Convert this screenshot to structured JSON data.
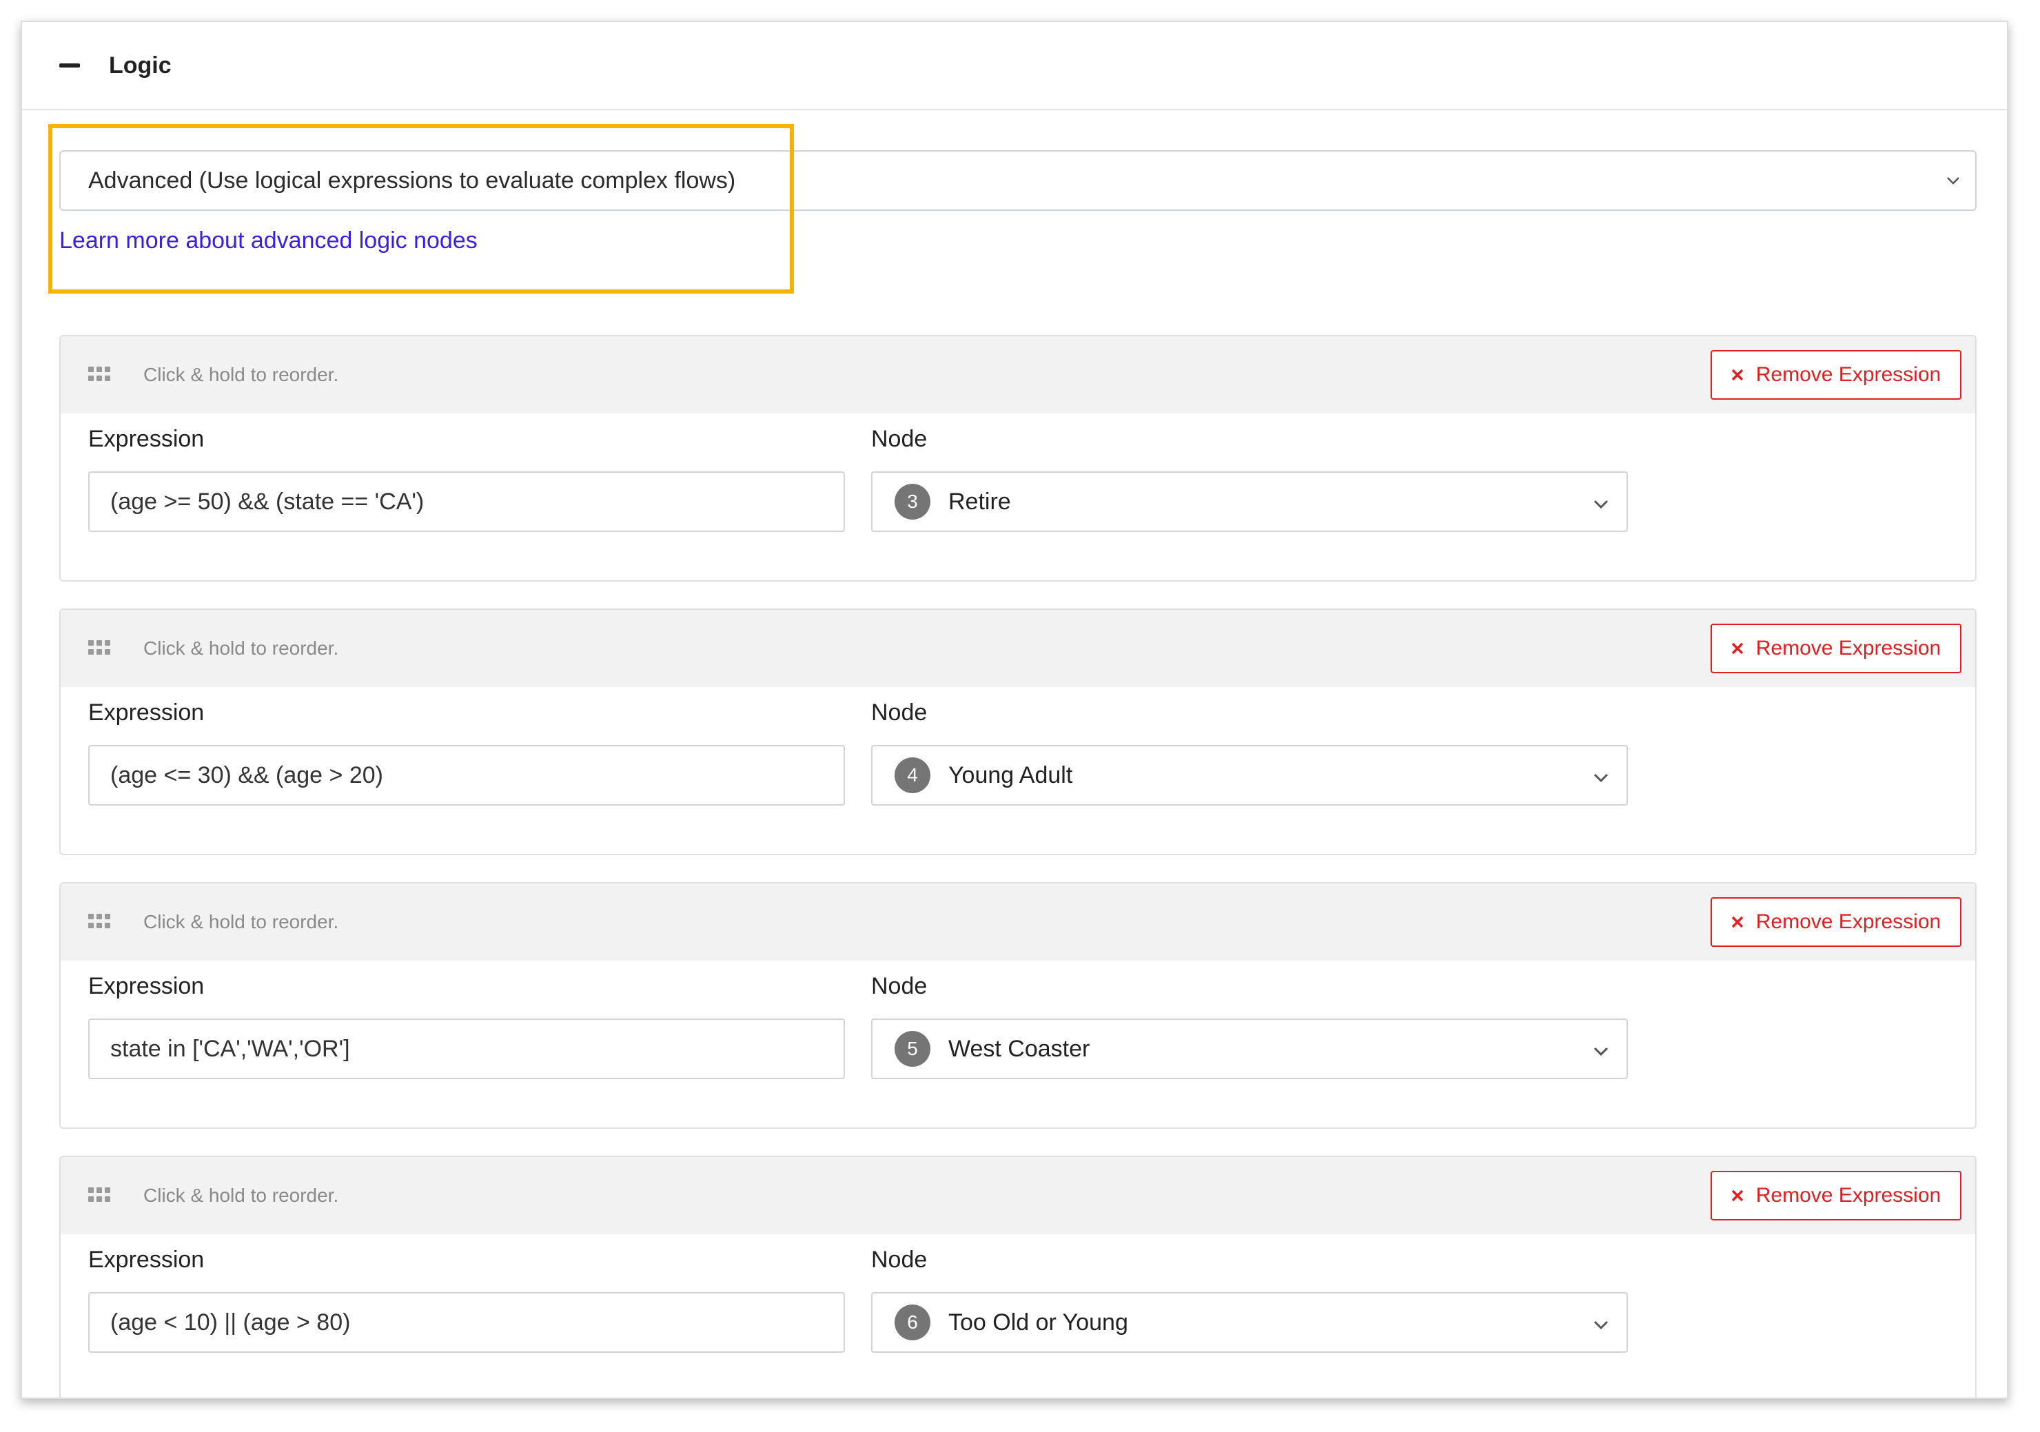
{
  "panel": {
    "title": "Logic",
    "collapse_icon": "minus-icon"
  },
  "mode": {
    "selected": "Advanced (Use logical expressions to evaluate complex flows)",
    "learn_more": "Learn more about advanced logic nodes",
    "highlight_color": "#f6b400"
  },
  "labels": {
    "reorder_hint": "Click & hold to reorder.",
    "expression": "Expression",
    "node": "Node",
    "remove": "Remove Expression"
  },
  "expressions": [
    {
      "expression": "(age >= 50) && (state == 'CA')",
      "node_number": "3",
      "node_name": "Retire"
    },
    {
      "expression": "(age <= 30) && (age > 20)",
      "node_number": "4",
      "node_name": "Young Adult"
    },
    {
      "expression": "state in ['CA','WA','OR']",
      "node_number": "5",
      "node_name": "West Coaster"
    },
    {
      "expression": "(age < 10) || (age > 80)",
      "node_number": "6",
      "node_name": "Too Old or Young"
    }
  ],
  "colors": {
    "remove": "#e02020",
    "link": "#3b1ee6",
    "badge": "#757575"
  }
}
